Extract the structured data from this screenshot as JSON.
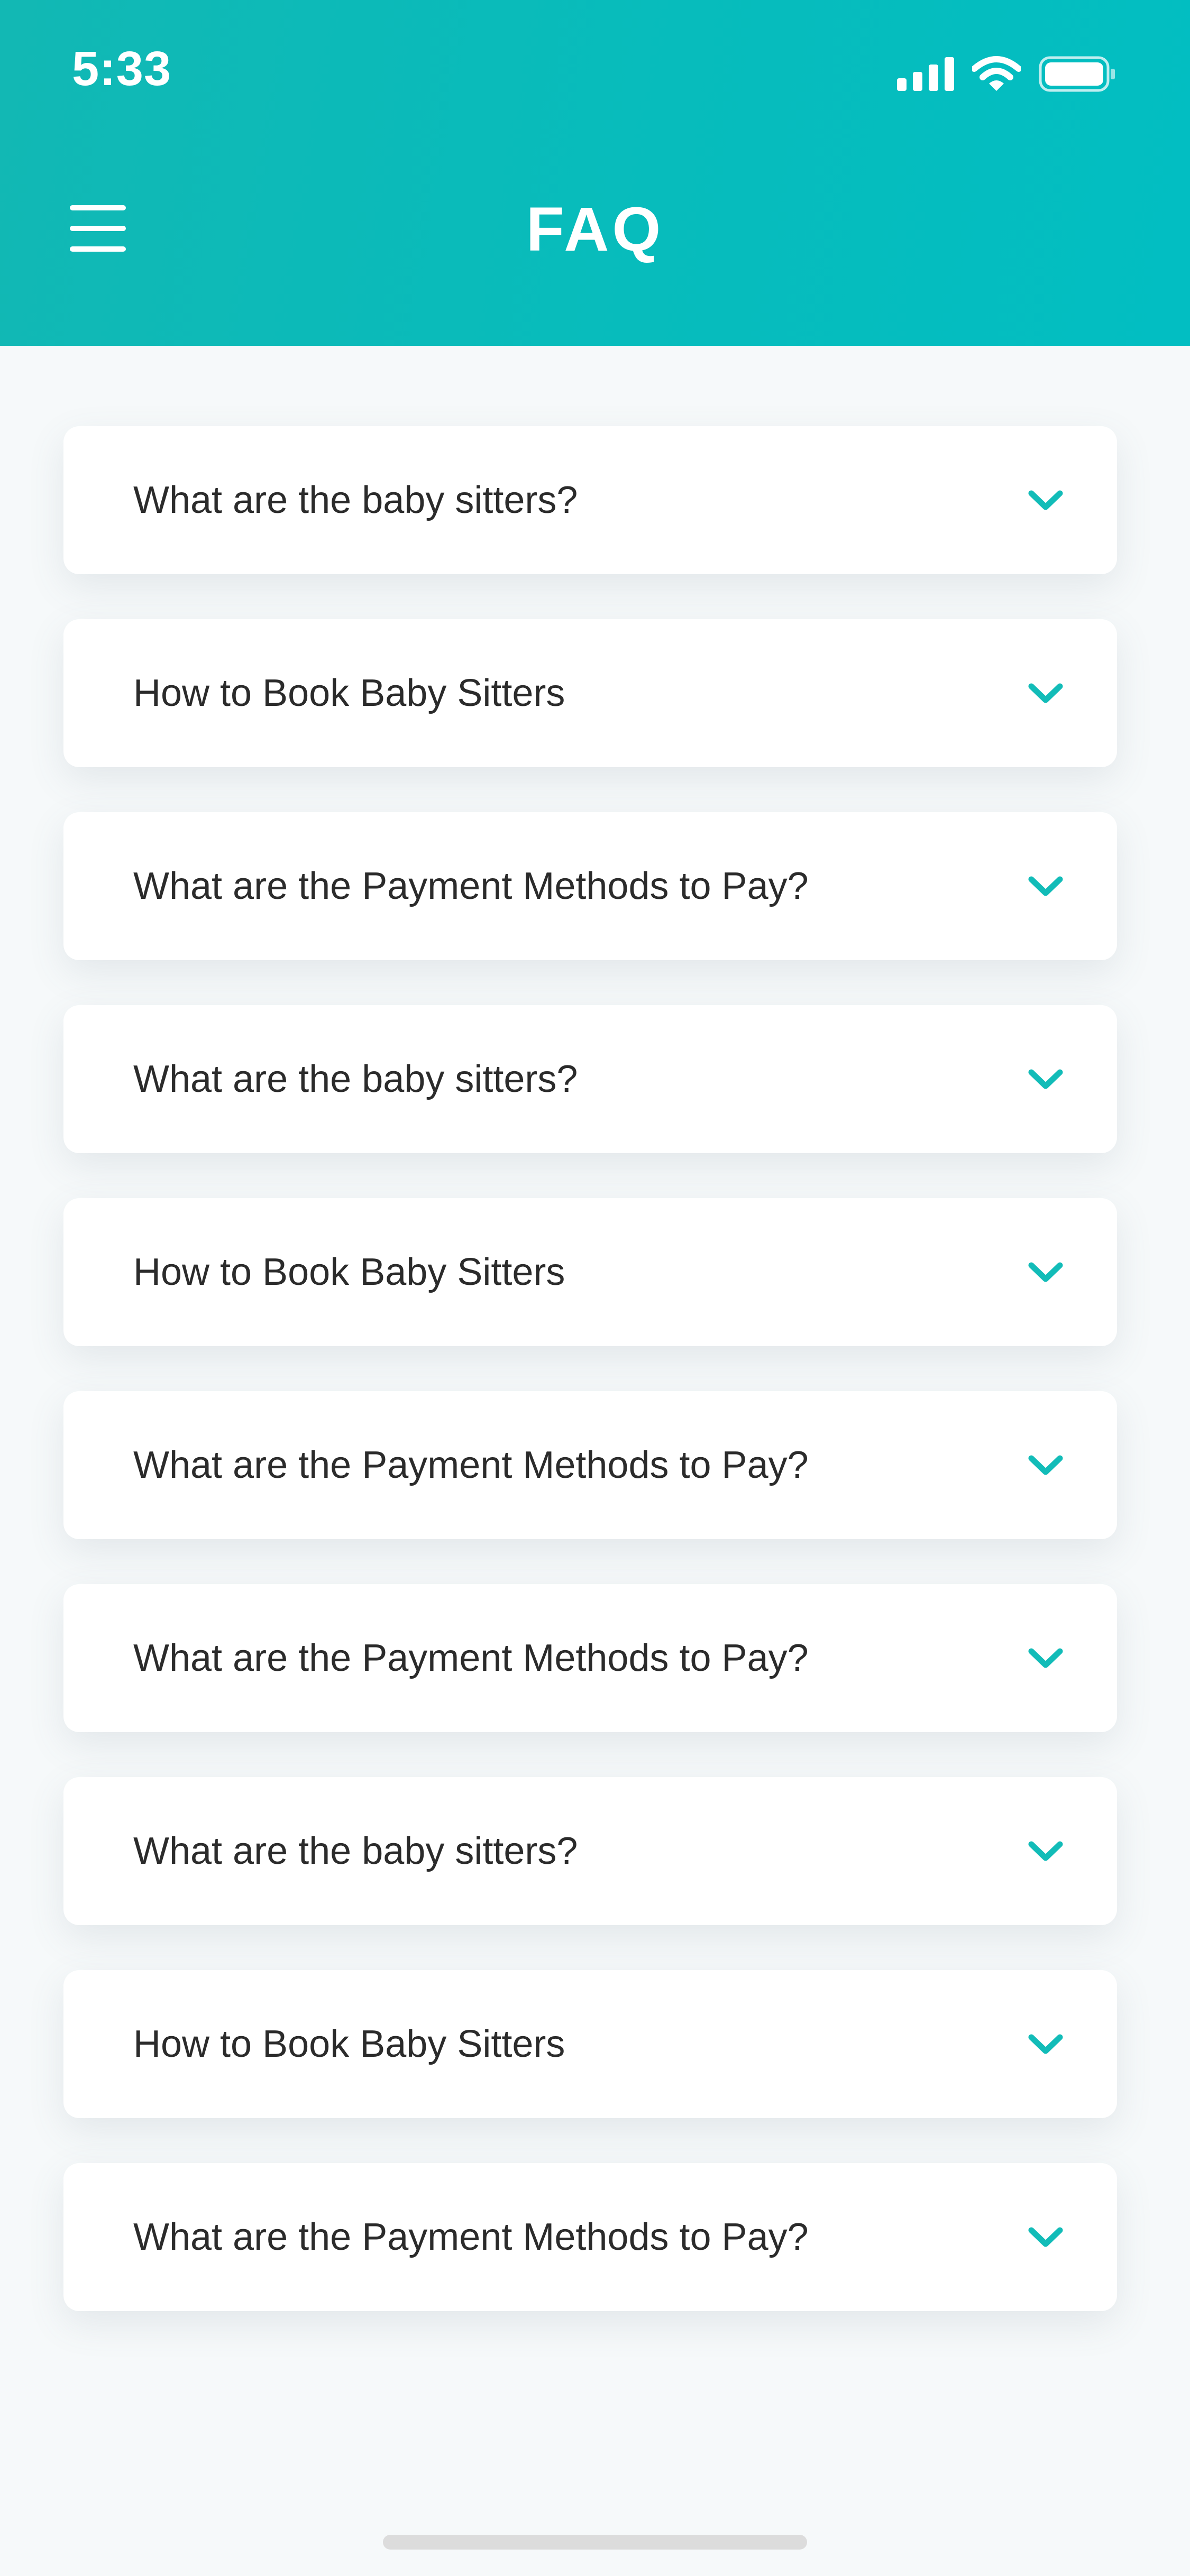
{
  "status_bar": {
    "time": "5:33",
    "icons": [
      "signal-icon",
      "wifi-icon",
      "battery-icon"
    ]
  },
  "header": {
    "title": "FAQ",
    "menu_icon": "hamburger-menu-icon",
    "gradient_colors": [
      "#12b8b4",
      "#02bec2"
    ]
  },
  "faq": {
    "items": [
      {
        "question": "What are the baby sitters?",
        "icon": "chevron-down-icon"
      },
      {
        "question": "How to Book Baby Sitters",
        "icon": "chevron-down-icon"
      },
      {
        "question": "What are the Payment Methods to Pay?",
        "icon": "chevron-down-icon"
      },
      {
        "question": "What are the baby sitters?",
        "icon": "chevron-down-icon"
      },
      {
        "question": "How to Book Baby Sitters",
        "icon": "chevron-down-icon"
      },
      {
        "question": "What are the Payment Methods to Pay?",
        "icon": "chevron-down-icon"
      },
      {
        "question": "What are the Payment Methods to Pay?",
        "icon": "chevron-down-icon"
      },
      {
        "question": "What are the baby sitters?",
        "icon": "chevron-down-icon"
      },
      {
        "question": "How to Book Baby Sitters",
        "icon": "chevron-down-icon"
      },
      {
        "question": "What are the Payment Methods to Pay?",
        "icon": "chevron-down-icon"
      }
    ]
  },
  "colors": {
    "accent": "#12bcb8",
    "background": "#f6f9fa",
    "card": "#ffffff",
    "text": "#2b2b2b"
  }
}
